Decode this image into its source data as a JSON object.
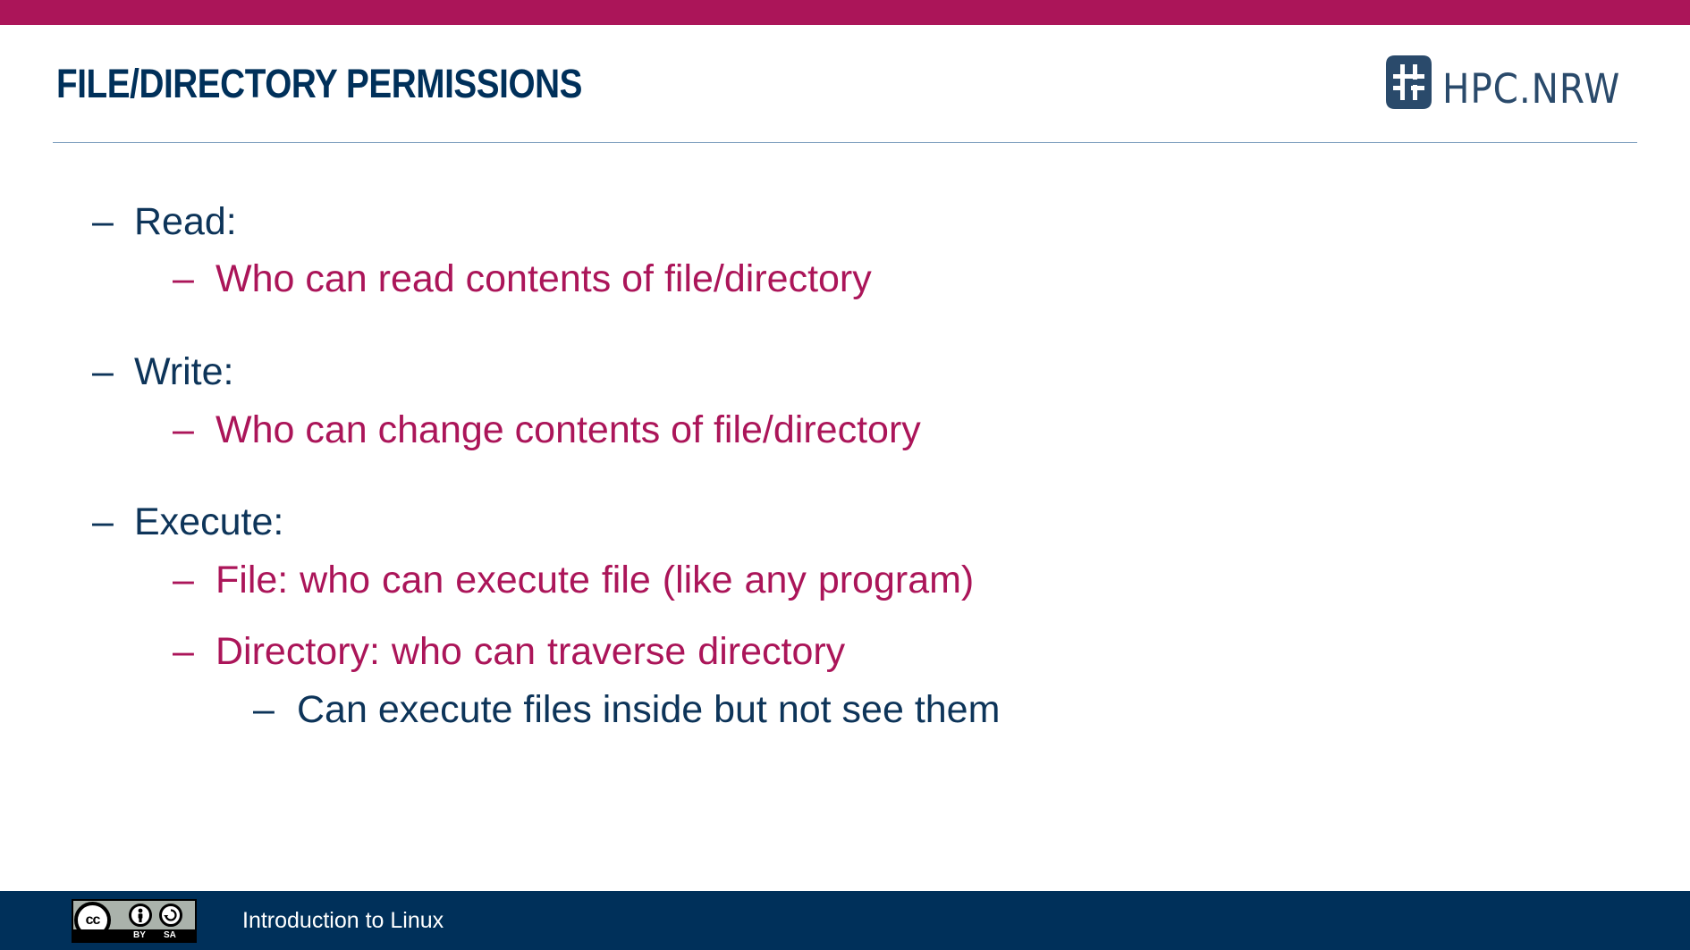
{
  "slide": {
    "title": "FILE/DIRECTORY PERMISSIONS",
    "logo_text": "HPC.NRW",
    "logo_icon": "hash-icon",
    "colors": {
      "accent": "#ab1559",
      "navy": "#00305a",
      "text_primary": "#0d3459",
      "rule": "#7f9fbf"
    }
  },
  "bullets": [
    {
      "level": 1,
      "dash": "–",
      "text": "Read:"
    },
    {
      "level": 2,
      "dash": "–",
      "text": "Who can read contents of file/directory"
    },
    {
      "level": 1,
      "dash": "–",
      "text": "Write:"
    },
    {
      "level": 2,
      "dash": "–",
      "text": "Who can change contents of file/directory"
    },
    {
      "level": 1,
      "dash": "–",
      "text": "Execute:"
    },
    {
      "level": 2,
      "dash": "–",
      "text": "File: who can execute file (like any program)"
    },
    {
      "level": 2,
      "dash": "–",
      "text": "Directory: who can traverse directory"
    },
    {
      "level": 3,
      "dash": "–",
      "text": "Can execute files inside but not see them"
    }
  ],
  "footer": {
    "license_badge": {
      "cc": "cc",
      "by": "BY",
      "sa": "SA",
      "by_icon": "person-icon",
      "sa_icon": "share-alike-icon"
    },
    "course_title": "Introduction to Linux"
  }
}
